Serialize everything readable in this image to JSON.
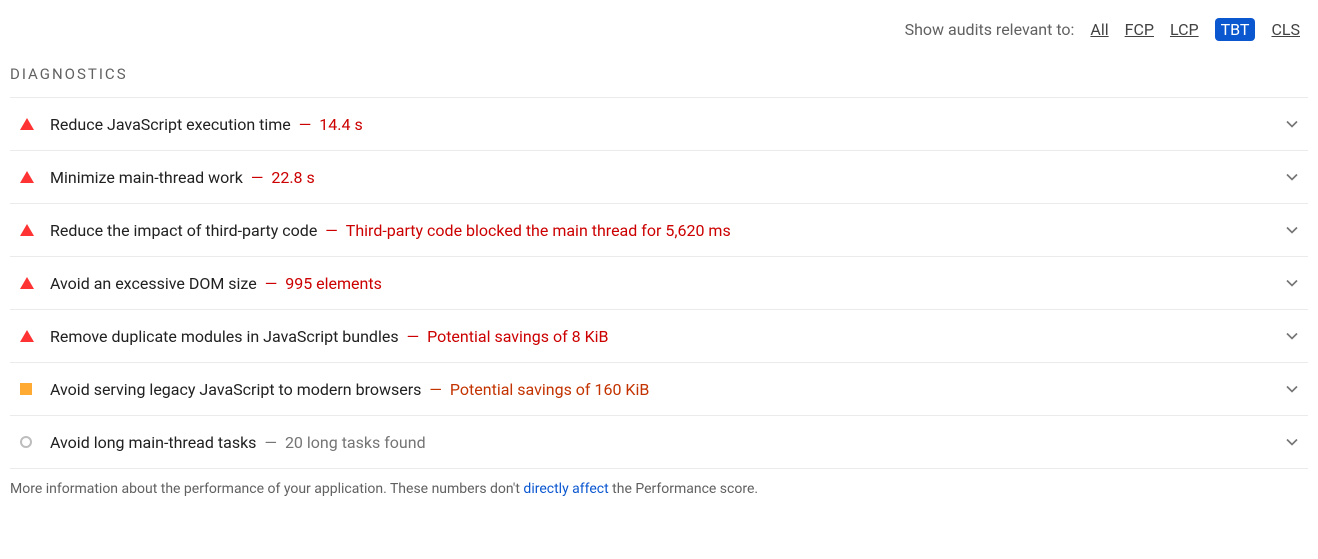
{
  "filter": {
    "label": "Show audits relevant to:",
    "items": [
      {
        "label": "All",
        "active": false
      },
      {
        "label": "FCP",
        "active": false
      },
      {
        "label": "LCP",
        "active": false
      },
      {
        "label": "TBT",
        "active": true
      },
      {
        "label": "CLS",
        "active": false
      }
    ]
  },
  "section_header": "DIAGNOSTICS",
  "audits": [
    {
      "severity": "fail",
      "title": "Reduce JavaScript execution time",
      "value": "14.4 s"
    },
    {
      "severity": "fail",
      "title": "Minimize main-thread work",
      "value": "22.8 s"
    },
    {
      "severity": "fail",
      "title": "Reduce the impact of third-party code",
      "value": "Third-party code blocked the main thread for 5,620 ms"
    },
    {
      "severity": "fail",
      "title": "Avoid an excessive DOM size",
      "value": "995 elements"
    },
    {
      "severity": "fail",
      "title": "Remove duplicate modules in JavaScript bundles",
      "value": "Potential savings of 8 KiB"
    },
    {
      "severity": "average",
      "title": "Avoid serving legacy JavaScript to modern browsers",
      "value": "Potential savings of 160 KiB"
    },
    {
      "severity": "informative",
      "title": "Avoid long main-thread tasks",
      "value": "20 long tasks found"
    }
  ],
  "footer": {
    "prefix": "More information about the performance of your application. These numbers don't ",
    "link": "directly affect",
    "suffix": " the Performance score."
  }
}
